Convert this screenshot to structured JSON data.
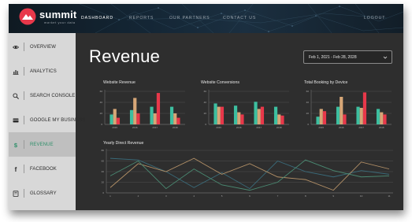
{
  "brand": {
    "name": "summit",
    "tagline": "market your data"
  },
  "nav": [
    {
      "label": "DASHBOARD",
      "active": true
    },
    {
      "label": "REPORTS",
      "active": false
    },
    {
      "label": "OUR PARTNERS",
      "active": false
    },
    {
      "label": "CONTACT US",
      "active": false
    },
    {
      "label": "LOGOUT",
      "active": false
    }
  ],
  "sidebar": {
    "items": [
      {
        "label": "OVERVIEW",
        "icon": "eye-icon",
        "active": false
      },
      {
        "label": "ANALYTICS",
        "icon": "bar-chart-icon",
        "active": false
      },
      {
        "label": "SEARCH CONSOLE",
        "icon": "search-icon",
        "active": false
      },
      {
        "label": "GOOGLE MY BUSINESS",
        "icon": "card-icon",
        "active": false
      },
      {
        "label": "REVENUE",
        "icon": "dollar-icon",
        "active": true
      },
      {
        "label": "FACEBOOK",
        "icon": "facebook-icon",
        "active": false
      },
      {
        "label": "GLOSSARY",
        "icon": "book-icon",
        "active": false
      }
    ],
    "active_color": "#2e8f69"
  },
  "main": {
    "title": "Revenue",
    "date_range": "Feb 1, 2021 - Feb 28, 2028"
  },
  "colors": {
    "teal": "#3dbfa0",
    "tan": "#d6a677",
    "red": "#e8384a",
    "line_blue": "#3a6b7a",
    "line_green": "#4a8a72",
    "line_tan": "#b39067",
    "accent": "#2e8f69"
  },
  "chart_data": [
    {
      "type": "bar",
      "title": "Website Revenue",
      "categories": [
        "2015",
        "2016",
        "2017",
        "2018"
      ],
      "ylim": [
        0,
        60
      ],
      "yticks": [
        "0",
        "20",
        "40",
        "60"
      ],
      "series": [
        {
          "values": [
            18,
            26,
            32,
            32
          ]
        },
        {
          "values": [
            28,
            48,
            20,
            20
          ]
        },
        {
          "values": [
            12,
            20,
            57,
            12
          ]
        }
      ]
    },
    {
      "type": "bar",
      "title": "Website Conversions",
      "categories": [
        "2015",
        "2016",
        "2017",
        "2018"
      ],
      "ylim": [
        0,
        60
      ],
      "yticks": [
        "0",
        "20",
        "40",
        "60"
      ],
      "series": [
        {
          "values": [
            38,
            34,
            41,
            32
          ]
        },
        {
          "values": [
            32,
            22,
            28,
            18
          ]
        },
        {
          "values": [
            32,
            18,
            32,
            16
          ]
        }
      ]
    },
    {
      "type": "bar",
      "title": "Total Booking by Device",
      "categories": [
        "2015",
        "2016",
        "2017",
        "2018"
      ],
      "ylim": [
        0,
        60
      ],
      "yticks": [
        "0",
        "20",
        "40",
        "60"
      ],
      "series": [
        {
          "values": [
            14,
            32,
            32,
            28
          ]
        },
        {
          "values": [
            28,
            50,
            30,
            22
          ]
        },
        {
          "values": [
            24,
            18,
            58,
            18
          ]
        }
      ]
    },
    {
      "type": "line",
      "title": "Yearly Direct Revenue",
      "x": [
        "1",
        "2",
        "3",
        "4",
        "5",
        "6",
        "7",
        "8",
        "9",
        "10",
        "11"
      ],
      "ylim": [
        0,
        80
      ],
      "yticks": [
        "0",
        "20",
        "40",
        "60",
        "80"
      ],
      "series": [
        {
          "values": [
            65,
            62,
            40,
            10,
            38,
            8,
            60,
            40,
            30,
            42,
            35
          ]
        },
        {
          "values": [
            10,
            55,
            40,
            65,
            35,
            55,
            30,
            25,
            5,
            58,
            45
          ]
        },
        {
          "values": [
            32,
            60,
            8,
            45,
            15,
            5,
            20,
            62,
            42,
            30,
            32
          ]
        }
      ]
    }
  ]
}
